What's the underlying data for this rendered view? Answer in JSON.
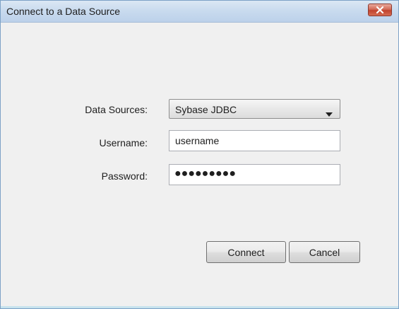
{
  "window": {
    "title": "Connect to a Data Source"
  },
  "form": {
    "data_sources_label": "Data Sources:",
    "data_source_selected": "Sybase JDBC",
    "username_label": "Username:",
    "username_value": "username",
    "password_label": "Password:",
    "password_mask": "●●●●●●●●●"
  },
  "buttons": {
    "connect_label": "Connect",
    "cancel_label": "Cancel"
  },
  "icons": {
    "close": "close-icon",
    "dropdown": "chevron-down-icon"
  },
  "colors": {
    "close_button": "#c1432d",
    "titlebar": "#c8daee"
  }
}
